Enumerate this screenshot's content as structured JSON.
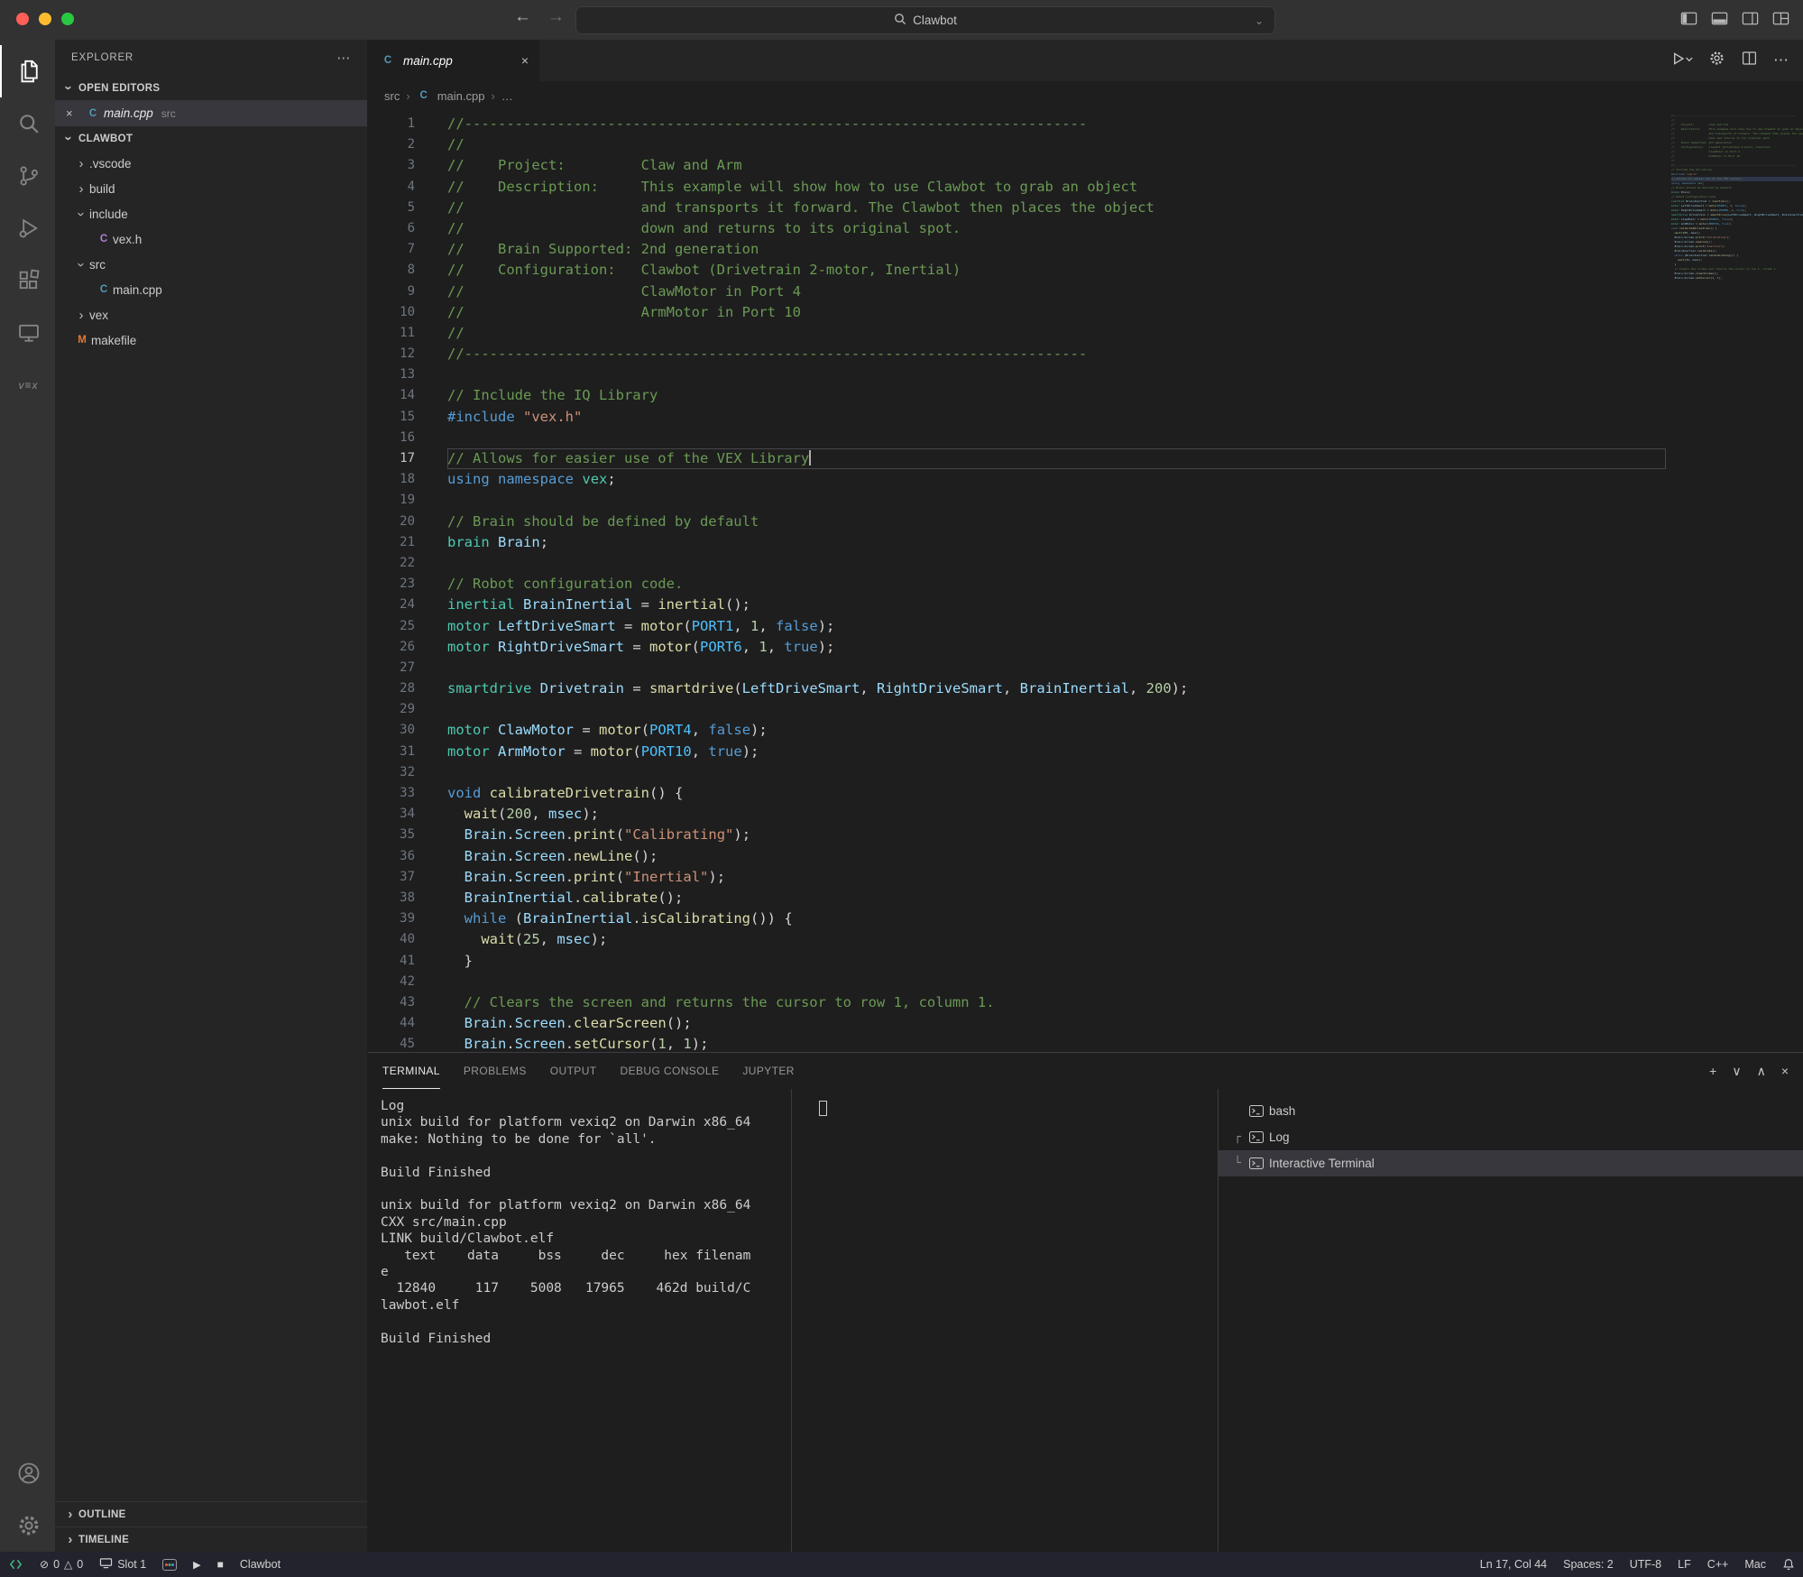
{
  "icons": {
    "chevron": "›",
    "close": "×",
    "ellipsis": "⋯",
    "back": "←",
    "forward": "→",
    "play": "▶",
    "stop": "■",
    "error": "⊘",
    "warning": "△",
    "breadcrumb_sep": "›",
    "pill_chevron": "⌄"
  },
  "titlebar": {
    "title": "Clawbot"
  },
  "sidebar": {
    "header": "EXPLORER",
    "file_icon_glyphs": {
      "cpp": {
        "glyph": "C",
        "color": "#519aba"
      },
      "h": {
        "glyph": "C",
        "color": "#b180d7"
      },
      "makefile": {
        "glyph": "M",
        "color": "#e37933"
      }
    },
    "open_editors": {
      "label": "OPEN EDITORS",
      "item": {
        "file": "main.cpp",
        "detail": "src"
      }
    },
    "project": {
      "label": "CLAWBOT",
      "tree": [
        {
          "kind": "folder",
          "name": ".vscode",
          "expanded": false,
          "depth": 0
        },
        {
          "kind": "folder",
          "name": "build",
          "expanded": false,
          "depth": 0
        },
        {
          "kind": "folder",
          "name": "include",
          "expanded": true,
          "depth": 0
        },
        {
          "kind": "file",
          "name": "vex.h",
          "icon": "h",
          "depth": 1
        },
        {
          "kind": "folder",
          "name": "src",
          "expanded": true,
          "depth": 0
        },
        {
          "kind": "file",
          "name": "main.cpp",
          "icon": "cpp",
          "depth": 1
        },
        {
          "kind": "folder",
          "name": "vex",
          "expanded": false,
          "depth": 0
        },
        {
          "kind": "file",
          "name": "makefile",
          "icon": "makefile",
          "depth": 0
        }
      ]
    },
    "footer_sections": [
      "OUTLINE",
      "TIMELINE"
    ]
  },
  "editor": {
    "tab": {
      "label": "main.cpp"
    },
    "breadcrumbs": {
      "first": "src",
      "second": "main.cpp",
      "third": "…"
    },
    "cursor_line": 17,
    "lines": [
      [
        [
          "c",
          "//--------------------------------------------------------------------------"
        ]
      ],
      [
        [
          "c",
          "//"
        ]
      ],
      [
        [
          "c",
          "//    Project:         Claw and Arm"
        ]
      ],
      [
        [
          "c",
          "//    Description:     This example will show how to use Clawbot to grab an object"
        ]
      ],
      [
        [
          "c",
          "//                     and transports it forward. The Clawbot then places the object"
        ]
      ],
      [
        [
          "c",
          "//                     down and returns to its original spot."
        ]
      ],
      [
        [
          "c",
          "//    Brain Supported: 2nd generation"
        ]
      ],
      [
        [
          "c",
          "//    Configuration:   Clawbot (Drivetrain 2-motor, Inertial)"
        ]
      ],
      [
        [
          "c",
          "//                     ClawMotor in Port 4"
        ]
      ],
      [
        [
          "c",
          "//                     ArmMotor in Port 10"
        ]
      ],
      [
        [
          "c",
          "//"
        ]
      ],
      [
        [
          "c",
          "//--------------------------------------------------------------------------"
        ]
      ],
      [],
      [
        [
          "c",
          "// Include the IQ Library"
        ]
      ],
      [
        [
          "k",
          "#include"
        ],
        [
          "p",
          " "
        ],
        [
          "s",
          "\"vex.h\""
        ]
      ],
      [],
      [
        [
          "c",
          "// Allows for easier use of the VEX Library"
        ]
      ],
      [
        [
          "k",
          "using"
        ],
        [
          "p",
          " "
        ],
        [
          "k",
          "namespace"
        ],
        [
          "p",
          " "
        ],
        [
          "t",
          "vex"
        ],
        [
          "p",
          ";"
        ]
      ],
      [],
      [
        [
          "c",
          "// Brain should be defined by default"
        ]
      ],
      [
        [
          "t",
          "brain"
        ],
        [
          "p",
          " "
        ],
        [
          "v",
          "Brain"
        ],
        [
          "p",
          ";"
        ]
      ],
      [],
      [
        [
          "c",
          "// Robot configuration code."
        ]
      ],
      [
        [
          "t",
          "inertial"
        ],
        [
          "p",
          " "
        ],
        [
          "v",
          "BrainInertial"
        ],
        [
          "p",
          " = "
        ],
        [
          "f",
          "inertial"
        ],
        [
          "p",
          "();"
        ]
      ],
      [
        [
          "t",
          "motor"
        ],
        [
          "p",
          " "
        ],
        [
          "v",
          "LeftDriveSmart"
        ],
        [
          "p",
          " = "
        ],
        [
          "f",
          "motor"
        ],
        [
          "p",
          "("
        ],
        [
          "o",
          "PORT1"
        ],
        [
          "p",
          ", "
        ],
        [
          "n",
          "1"
        ],
        [
          "p",
          ", "
        ],
        [
          "k",
          "false"
        ],
        [
          "p",
          ");"
        ]
      ],
      [
        [
          "t",
          "motor"
        ],
        [
          "p",
          " "
        ],
        [
          "v",
          "RightDriveSmart"
        ],
        [
          "p",
          " = "
        ],
        [
          "f",
          "motor"
        ],
        [
          "p",
          "("
        ],
        [
          "o",
          "PORT6"
        ],
        [
          "p",
          ", "
        ],
        [
          "n",
          "1"
        ],
        [
          "p",
          ", "
        ],
        [
          "k",
          "true"
        ],
        [
          "p",
          ");"
        ]
      ],
      [],
      [
        [
          "t",
          "smartdrive"
        ],
        [
          "p",
          " "
        ],
        [
          "v",
          "Drivetrain"
        ],
        [
          "p",
          " = "
        ],
        [
          "f",
          "smartdrive"
        ],
        [
          "p",
          "("
        ],
        [
          "v",
          "LeftDriveSmart"
        ],
        [
          "p",
          ", "
        ],
        [
          "v",
          "RightDriveSmart"
        ],
        [
          "p",
          ", "
        ],
        [
          "v",
          "BrainInertial"
        ],
        [
          "p",
          ", "
        ],
        [
          "n",
          "200"
        ],
        [
          "p",
          ");"
        ]
      ],
      [],
      [
        [
          "t",
          "motor"
        ],
        [
          "p",
          " "
        ],
        [
          "v",
          "ClawMotor"
        ],
        [
          "p",
          " = "
        ],
        [
          "f",
          "motor"
        ],
        [
          "p",
          "("
        ],
        [
          "o",
          "PORT4"
        ],
        [
          "p",
          ", "
        ],
        [
          "k",
          "false"
        ],
        [
          "p",
          ");"
        ]
      ],
      [
        [
          "t",
          "motor"
        ],
        [
          "p",
          " "
        ],
        [
          "v",
          "ArmMotor"
        ],
        [
          "p",
          " = "
        ],
        [
          "f",
          "motor"
        ],
        [
          "p",
          "("
        ],
        [
          "o",
          "PORT10"
        ],
        [
          "p",
          ", "
        ],
        [
          "k",
          "true"
        ],
        [
          "p",
          ");"
        ]
      ],
      [],
      [
        [
          "k",
          "void"
        ],
        [
          "p",
          " "
        ],
        [
          "f",
          "calibrateDrivetrain"
        ],
        [
          "p",
          "() {"
        ]
      ],
      [
        [
          "p",
          "  "
        ],
        [
          "f",
          "wait"
        ],
        [
          "p",
          "("
        ],
        [
          "n",
          "200"
        ],
        [
          "p",
          ", "
        ],
        [
          "v",
          "msec"
        ],
        [
          "p",
          ");"
        ]
      ],
      [
        [
          "p",
          "  "
        ],
        [
          "v",
          "Brain"
        ],
        [
          "p",
          "."
        ],
        [
          "v",
          "Screen"
        ],
        [
          "p",
          "."
        ],
        [
          "f",
          "print"
        ],
        [
          "p",
          "("
        ],
        [
          "s",
          "\"Calibrating\""
        ],
        [
          "p",
          ");"
        ]
      ],
      [
        [
          "p",
          "  "
        ],
        [
          "v",
          "Brain"
        ],
        [
          "p",
          "."
        ],
        [
          "v",
          "Screen"
        ],
        [
          "p",
          "."
        ],
        [
          "f",
          "newLine"
        ],
        [
          "p",
          "();"
        ]
      ],
      [
        [
          "p",
          "  "
        ],
        [
          "v",
          "Brain"
        ],
        [
          "p",
          "."
        ],
        [
          "v",
          "Screen"
        ],
        [
          "p",
          "."
        ],
        [
          "f",
          "print"
        ],
        [
          "p",
          "("
        ],
        [
          "s",
          "\"Inertial\""
        ],
        [
          "p",
          ");"
        ]
      ],
      [
        [
          "p",
          "  "
        ],
        [
          "v",
          "BrainInertial"
        ],
        [
          "p",
          "."
        ],
        [
          "f",
          "calibrate"
        ],
        [
          "p",
          "();"
        ]
      ],
      [
        [
          "p",
          "  "
        ],
        [
          "k",
          "while"
        ],
        [
          "p",
          " ("
        ],
        [
          "v",
          "BrainInertial"
        ],
        [
          "p",
          "."
        ],
        [
          "f",
          "isCalibrating"
        ],
        [
          "p",
          "()) {"
        ]
      ],
      [
        [
          "p",
          "    "
        ],
        [
          "f",
          "wait"
        ],
        [
          "p",
          "("
        ],
        [
          "n",
          "25"
        ],
        [
          "p",
          ", "
        ],
        [
          "v",
          "msec"
        ],
        [
          "p",
          ");"
        ]
      ],
      [
        [
          "p",
          "  }"
        ]
      ],
      [],
      [
        [
          "p",
          "  "
        ],
        [
          "c",
          "// Clears the screen and returns the cursor to row 1, column 1."
        ]
      ],
      [
        [
          "p",
          "  "
        ],
        [
          "v",
          "Brain"
        ],
        [
          "p",
          "."
        ],
        [
          "v",
          "Screen"
        ],
        [
          "p",
          "."
        ],
        [
          "f",
          "clearScreen"
        ],
        [
          "p",
          "();"
        ]
      ],
      [
        [
          "p",
          "  "
        ],
        [
          "v",
          "Brain"
        ],
        [
          "p",
          "."
        ],
        [
          "v",
          "Screen"
        ],
        [
          "p",
          "."
        ],
        [
          "f",
          "setCursor"
        ],
        [
          "p",
          "("
        ],
        [
          "n",
          "1"
        ],
        [
          "p",
          ", "
        ],
        [
          "n",
          "1"
        ],
        [
          "p",
          ");"
        ]
      ]
    ]
  },
  "panel": {
    "tabs": [
      {
        "label": "TERMINAL",
        "active": true
      },
      {
        "label": "PROBLEMS",
        "active": false
      },
      {
        "label": "OUTPUT",
        "active": false
      },
      {
        "label": "DEBUG CONSOLE",
        "active": false
      },
      {
        "label": "JUPYTER",
        "active": false
      }
    ],
    "actions": [
      {
        "name": "new-terminal-icon",
        "glyph": "+"
      },
      {
        "name": "terminal-picker-chevron-icon",
        "glyph": "∨"
      },
      {
        "name": "maximize-panel-icon",
        "glyph": "∧"
      },
      {
        "name": "close-panel-icon",
        "glyph": "×"
      }
    ],
    "terminal_output": [
      "Log",
      "unix build for platform vexiq2 on Darwin x86_64",
      "make: Nothing to be done for `all'.",
      "",
      "Build Finished",
      "",
      "unix build for platform vexiq2 on Darwin x86_64",
      "CXX src/main.cpp",
      "LINK build/Clawbot.elf",
      "   text    data     bss     dec     hex filenam",
      "e",
      "  12840     117    5008   17965    462d build/C",
      "lawbot.elf",
      "",
      "Build Finished"
    ],
    "terminal_list": [
      {
        "label": "bash",
        "connector": "",
        "selected": false
      },
      {
        "label": "Log",
        "connector": "┌",
        "selected": false
      },
      {
        "label": "Interactive Terminal",
        "connector": "└",
        "selected": true
      }
    ]
  },
  "status_bar": {
    "errors": "0",
    "warnings": "0",
    "slot": "Slot 1",
    "project": "Clawbot",
    "right_items": [
      {
        "name": "cursor-position",
        "label": "Ln 17, Col 44"
      },
      {
        "name": "indentation",
        "label": "Spaces: 2"
      },
      {
        "name": "encoding",
        "label": "UTF-8"
      },
      {
        "name": "eol",
        "label": "LF"
      },
      {
        "name": "language-mode",
        "label": "C++"
      },
      {
        "name": "keymap",
        "label": "Mac"
      }
    ]
  }
}
